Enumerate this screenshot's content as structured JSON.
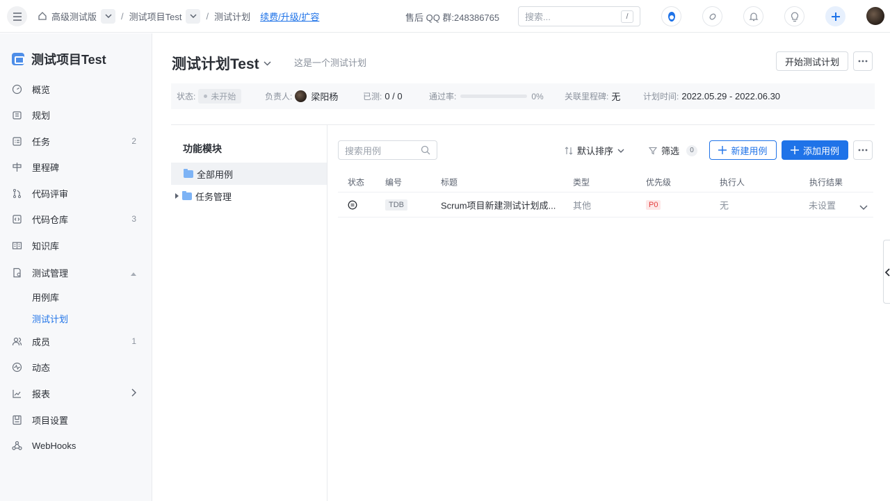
{
  "topbar": {
    "breadcrumbs": [
      "高级测试版",
      "测试项目Test",
      "测试计划"
    ],
    "upgrade_link": "续费/升级/扩容",
    "qq_group": "售后 QQ 群:248386765",
    "search_placeholder": "搜索...",
    "search_shortcut": "/"
  },
  "sidebar": {
    "project_name": "测试项目Test",
    "items": [
      {
        "label": "概览",
        "icon": "gauge-icon",
        "count": ""
      },
      {
        "label": "规划",
        "icon": "calendar-icon",
        "count": ""
      },
      {
        "label": "任务",
        "icon": "task-icon",
        "count": "2"
      },
      {
        "label": "里程碑",
        "icon": "milestone-icon",
        "count": ""
      },
      {
        "label": "代码评审",
        "icon": "merge-icon",
        "count": ""
      },
      {
        "label": "代码仓库",
        "icon": "code-icon",
        "count": "3"
      },
      {
        "label": "知识库",
        "icon": "book-icon",
        "count": ""
      },
      {
        "label": "测试管理",
        "icon": "test-icon",
        "count": ""
      },
      {
        "label": "成员",
        "icon": "members-icon",
        "count": "1"
      },
      {
        "label": "动态",
        "icon": "activity-icon",
        "count": ""
      },
      {
        "label": "报表",
        "icon": "chart-icon",
        "count": ""
      },
      {
        "label": "项目设置",
        "icon": "settings-icon",
        "count": ""
      },
      {
        "label": "WebHooks",
        "icon": "webhook-icon",
        "count": ""
      }
    ],
    "sub_items": [
      "用例库",
      "测试计划"
    ]
  },
  "plan": {
    "title": "测试计划Test",
    "description": "这是一个测试计划",
    "start_button": "开始测试计划",
    "info": {
      "status_label": "状态:",
      "status_value": "未开始",
      "owner_label": "负责人:",
      "owner_name": "梁阳杨",
      "tested_label": "已测:",
      "tested_value": "0 / 0",
      "pass_rate_label": "通过率:",
      "pass_rate_value": "0%",
      "pass_rate": 0,
      "milestone_label": "关联里程碑:",
      "milestone_value": "无",
      "time_label": "计划时间:",
      "time_value": "2022.05.29 - 2022.06.30"
    }
  },
  "modules": {
    "title": "功能模块",
    "items": [
      "全部用例",
      "任务管理"
    ]
  },
  "cases": {
    "search_placeholder": "搜索用例",
    "sort_label": "默认排序",
    "filter_label": "筛选",
    "filter_count": "0",
    "new_button": "新建用例",
    "add_button": "添加用例",
    "columns": [
      "状态",
      "编号",
      "标题",
      "类型",
      "优先级",
      "执行人",
      "执行结果"
    ],
    "rows": [
      {
        "code": "TDB",
        "title": "Scrum项目新建测试计划成...",
        "type": "其他",
        "priority": "P0",
        "executor": "无",
        "result": "未设置"
      }
    ]
  },
  "colors": {
    "accent": "#1f73e8",
    "priority_p0": "#e23c3c"
  }
}
